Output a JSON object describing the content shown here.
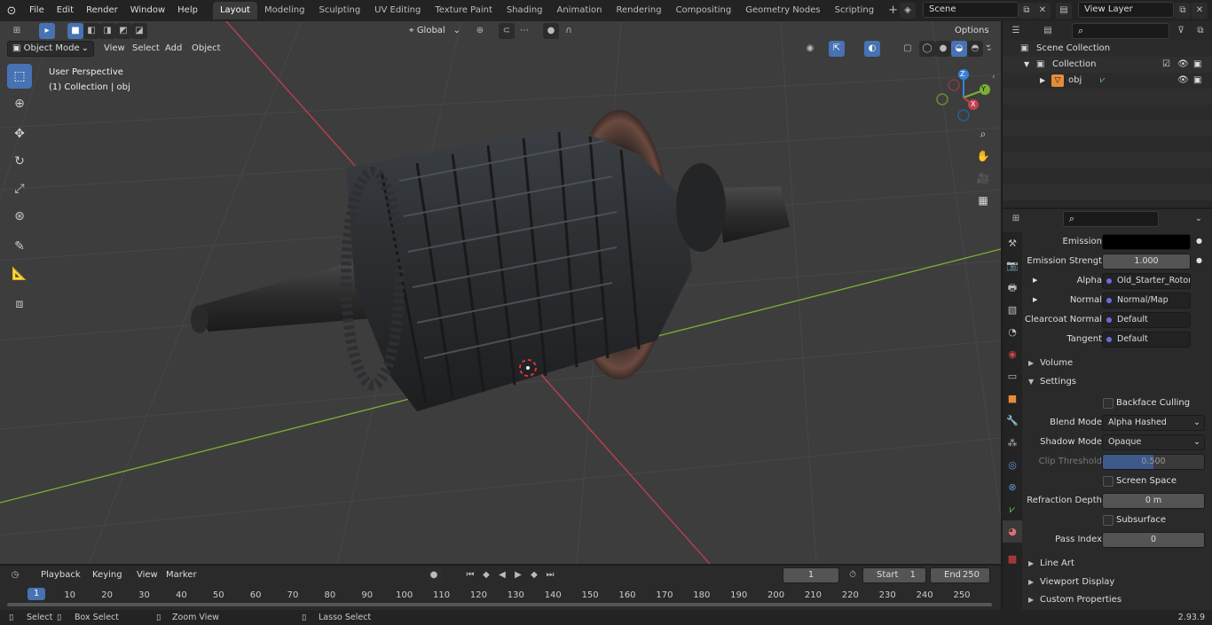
{
  "menu": [
    "File",
    "Edit",
    "Render",
    "Window",
    "Help"
  ],
  "workspaces": [
    "Layout",
    "Modeling",
    "Sculpting",
    "UV Editing",
    "Texture Paint",
    "Shading",
    "Animation",
    "Rendering",
    "Compositing",
    "Geometry Nodes",
    "Scripting"
  ],
  "active_workspace": "Layout",
  "scene": "Scene",
  "view_layer": "View Layer",
  "viewport": {
    "mode": "Object Mode",
    "menus": [
      "View",
      "Select",
      "Add",
      "Object"
    ],
    "transform_orientation": "Global",
    "options": "Options",
    "perspective_label": "User Perspective",
    "collection_label": "(1) Collection | obj"
  },
  "gizmo": {
    "z": "Z",
    "y": "Y",
    "x": "X"
  },
  "outliner": {
    "scene_collection": "Scene Collection",
    "collection": "Collection",
    "object": "obj"
  },
  "properties": {
    "emission_label": "Emission",
    "emission_strength_label": "Emission Strengt",
    "emission_strength_value": "1.000",
    "alpha_label": "Alpha",
    "alpha_value": "Old_Starter_Rotor_R...",
    "normal_label": "Normal",
    "normal_value": "Normal/Map",
    "clearcoat_normal_label": "Clearcoat Normal",
    "clearcoat_normal_value": "Default",
    "tangent_label": "Tangent",
    "tangent_value": "Default",
    "volume_section": "Volume",
    "settings_section": "Settings",
    "backface_culling": "Backface Culling",
    "blend_mode_label": "Blend Mode",
    "blend_mode_value": "Alpha Hashed",
    "shadow_mode_label": "Shadow Mode",
    "shadow_mode_value": "Opaque",
    "clip_threshold_label": "Clip Threshold",
    "clip_threshold_value": "0.500",
    "screen_space_refraction": "Screen Space Refraction",
    "refraction_depth_label": "Refraction Depth",
    "refraction_depth_value": "0 m",
    "subsurface_translucency": "Subsurface Translucency",
    "pass_index_label": "Pass Index",
    "pass_index_value": "0",
    "line_art_section": "Line Art",
    "viewport_display_section": "Viewport Display",
    "custom_properties_section": "Custom Properties"
  },
  "timeline": {
    "menus": [
      "Playback",
      "Keying",
      "View",
      "Marker"
    ],
    "current_frame": "1",
    "start_label": "Start",
    "start_value": "1",
    "end_label": "End",
    "end_value": "250",
    "ticks": [
      "1",
      "10",
      "20",
      "30",
      "40",
      "50",
      "60",
      "70",
      "80",
      "90",
      "100",
      "110",
      "120",
      "130",
      "140",
      "150",
      "160",
      "170",
      "180",
      "190",
      "200",
      "210",
      "220",
      "230",
      "240",
      "250"
    ]
  },
  "statusbar": {
    "select": "Select",
    "box_select": "Box Select",
    "zoom_view": "Zoom View",
    "lasso_select": "Lasso Select",
    "version": "2.93.9"
  },
  "colors": {
    "accent": "#4772b3",
    "x_axis": "#c3404f",
    "y_axis": "#7ab032",
    "z_axis": "#3a80d8"
  }
}
